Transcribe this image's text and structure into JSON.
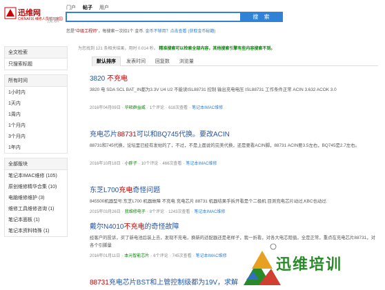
{
  "logo": {
    "name": "迅维网",
    "sub": "CHINAFIX 维修人员学习家园",
    "search": "搜索"
  },
  "search": {
    "tabs": [
      "门户",
      "帖子",
      "用户"
    ],
    "active_tab": "帖子",
    "value": "",
    "button": "搜 索",
    "info_a": "您是",
    "info_rank": "中级工程师",
    "info_b": "，每搜索一次扣1个 金币.",
    "info_link1": "金币不够用？点击查看",
    "info_link2": "(获取金币秘籍)"
  },
  "stats": {
    "text": "为您找到 121 条相关结果，用时 0.014 秒。",
    "notice": "精准搜索可以检索全部内容，其他搜索引擎有些内容搜索不到。"
  },
  "result_tabs": [
    "默认排序",
    "发表时间",
    "回复数",
    "浏览量"
  ],
  "sidebar": {
    "groups": [
      {
        "title": "全文检索",
        "items": [
          "只搜索标题"
        ]
      },
      {
        "title": "所有时间",
        "items": [
          "1小时内",
          "1天内",
          "1周内",
          "1个月内",
          "3个月内",
          "1年内"
        ]
      },
      {
        "title": "全部版块",
        "items": [
          "笔记本IMAC维修 (105)",
          "原创维修精华合集 (10)",
          "电脑维修维护 (3)",
          "维修工具维修咨询 (1)",
          "笔记本面板 (1)",
          "笔记本资料特殊 (1)"
        ]
      }
    ]
  },
  "results": [
    {
      "title_a": "3820 ",
      "title_b": "不充电",
      "title_c": "",
      "desc": "3820 电 SDA SCL BAT_IN都为3.3V U4 U2 不能读ISL88731 控制 输出充电电压 ISL88731 工作条件正常 ACIN 3.632 ACOK 3.0",
      "meta": {
        "date": "2016年04月09日",
        "user": "华硕群益威",
        "replies": "1个评论",
        "views": "618次查看",
        "forum": "笔记本IMAC维修"
      }
    },
    {
      "title_a": "充电芯片",
      "title_b": "88731",
      "title_c": "可以和BQ745代换。要改ACIN",
      "desc": "88731和745代换，论坛里已经有发帖的了，不过，不是上面说的完美代换，还是要看ACIN脚，88731 ACIN要3.5左右，BQ745是2.7左右。",
      "meta": {
        "date": "2016年10月18日",
        "user": "小胖子",
        "replies": "10个评论",
        "views": "466次查看",
        "forum": "笔记本IMAC维修"
      }
    },
    {
      "title_a": "东芝L700",
      "title_b": "充电",
      "title_c": "奇怪问题",
      "desc": "845500机器型号:东芝L700 机器故障 不充电 充电芯片 88731 机器结果手拆开看是个二极机 目测充电芯片动过,KBC也动过.",
      "meta": {
        "date": "2015年03月26日",
        "user": "我维修电子",
        "replies": "8个评论",
        "views": "1243次查看",
        "forum": "笔记本IMAC维修"
      }
    },
    {
      "title_a": "戴尔N4010",
      "title_b": "不充电",
      "title_c": "的奇怪故障",
      "desc": "经客户的投诉，买了新电池后装上去，发现不充电，换新的适配器还是老样子，我一折看，对各大电芯阻值，全是正常，重点在充电芯片88731，对各个引脚量",
      "meta": {
        "date": "2016年01月11日",
        "user": "本元智能芯片",
        "replies": "6个评论",
        "views": "745次查看",
        "forum": "笔记本IMAC维修"
      }
    },
    {
      "title_a": "",
      "title_b": "88731",
      "title_c": "充电芯片BST和上管控制级都为19V，求解",
      "desc": "",
      "meta": {
        "date": "",
        "user": "",
        "replies": "",
        "views": "",
        "forum": ""
      }
    }
  ],
  "watermark": {
    "text": "迅维培训"
  }
}
